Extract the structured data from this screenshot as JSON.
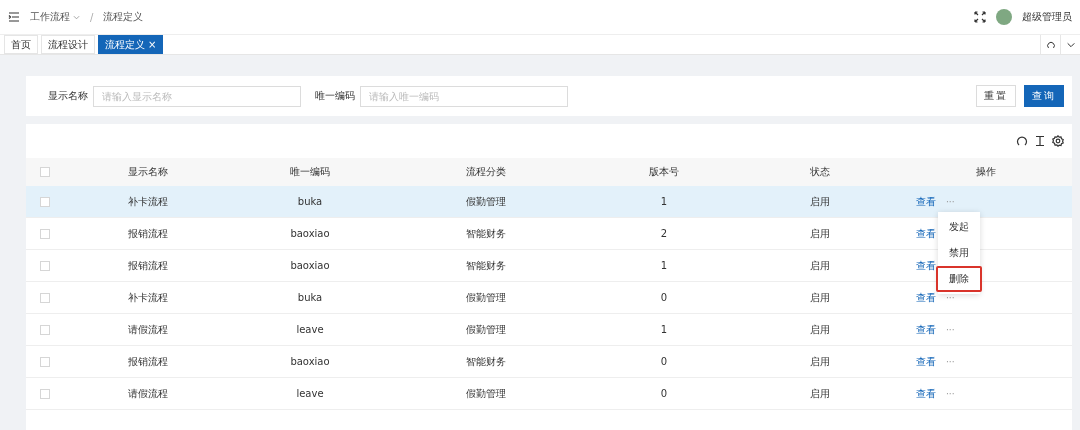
{
  "header": {
    "breadcrumb": [
      {
        "label": "工作流程",
        "has_dropdown": true
      },
      {
        "label": "流程定义",
        "has_dropdown": false
      }
    ],
    "separator": "/",
    "user": "超级管理员"
  },
  "tabs": [
    {
      "label": "首页",
      "selected": false,
      "closable": false
    },
    {
      "label": "流程设计",
      "selected": false,
      "closable": false
    },
    {
      "label": "流程定义",
      "selected": true,
      "closable": true
    }
  ],
  "close_glyph": "×",
  "search": {
    "fields": [
      {
        "label": "显示名称",
        "placeholder": "请输入显示名称"
      },
      {
        "label": "唯一编码",
        "placeholder": "请输入唯一编码"
      }
    ],
    "buttons": [
      {
        "label": "重置",
        "kind": "default"
      },
      {
        "label": "查询",
        "kind": "primary"
      }
    ]
  },
  "table": {
    "all_checked": false,
    "columns": [
      "显示名称",
      "唯一编码",
      "流程分类",
      "版本号",
      "状态",
      "操作"
    ],
    "rows": [
      {
        "cells": [
          "补卡流程",
          "buka",
          "假勤管理",
          "1",
          "启用"
        ],
        "checked": false,
        "hovered": true,
        "action": "查看",
        "more": "···"
      },
      {
        "cells": [
          "报销流程",
          "baoxiao",
          "智能财务",
          "2",
          "启用"
        ],
        "checked": false,
        "hovered": false,
        "action": "查看"
      },
      {
        "cells": [
          "报销流程",
          "baoxiao",
          "智能财务",
          "1",
          "启用"
        ],
        "checked": false,
        "hovered": false,
        "action": "查看"
      },
      {
        "cells": [
          "补卡流程",
          "buka",
          "假勤管理",
          "0",
          "启用"
        ],
        "checked": false,
        "hovered": false,
        "action": "查看",
        "more": "···"
      },
      {
        "cells": [
          "请假流程",
          "leave",
          "假勤管理",
          "1",
          "启用"
        ],
        "checked": false,
        "hovered": false,
        "action": "查看",
        "more": "···"
      },
      {
        "cells": [
          "报销流程",
          "baoxiao",
          "智能财务",
          "0",
          "启用"
        ],
        "checked": false,
        "hovered": false,
        "action": "查看",
        "more": "···"
      },
      {
        "cells": [
          "请假流程",
          "leave",
          "假勤管理",
          "0",
          "启用"
        ],
        "checked": false,
        "hovered": false,
        "action": "查看",
        "more": "···"
      }
    ]
  },
  "action_menu": {
    "items": [
      {
        "label": "发起",
        "highlighted": false
      },
      {
        "label": "禁用",
        "highlighted": false
      },
      {
        "label": "删除",
        "highlighted": true
      }
    ]
  }
}
